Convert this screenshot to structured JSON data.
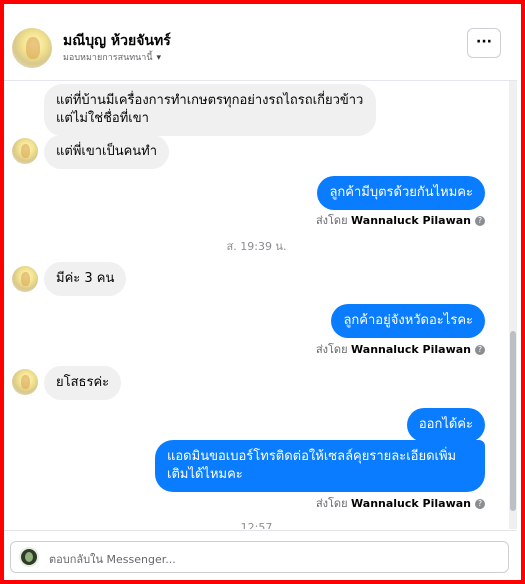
{
  "header": {
    "contact_name": "มณีบุญ ห้วยจันทร์",
    "assign_label": "มอบหมายการสนทนานี้",
    "caret_icon": "▾",
    "more_icon": "···"
  },
  "messages": {
    "m1": "แต่ที่บ้านมีเครื่องการทำเกษตรทุกอย่างรถไถรถเกี่ยวข้าวแต่ไม่ใช่ชื่อที่เขา",
    "m2": "แต่พี่เขาเป็นคนทำ",
    "m3": "ลูกค้ามีบุตรด้วยกันไหมคะ",
    "m3_sent_prefix": "ส่งโดย",
    "m3_sent_name": "Wannaluck Pilawan",
    "time1": "ส. 19:39 น.",
    "m4": "มีค่ะ 3 คน",
    "m5": "ลูกค้าอยู่จังหวัดอะไรคะ",
    "m5_sent_prefix": "ส่งโดย",
    "m5_sent_name": "Wannaluck Pilawan",
    "m6": "ยโสธรค่ะ",
    "m7": "ออกได้ค่ะ",
    "m8": "แอดมินขอเบอร์โทรติดต่อให้เซลล์คุยรายละเอียดเพิ่มเติมได้ไหมคะ",
    "m8_sent_prefix": "ส่งโดย",
    "m8_sent_name": "Wannaluck Pilawan",
    "time2": "12:57"
  },
  "composer": {
    "placeholder": "ตอบกลับใน Messenger..."
  },
  "colors": {
    "outgoing_bubble": "#0a7cff",
    "incoming_bubble": "#f0f0f0",
    "frame_border": "#ff0000"
  },
  "icons": {
    "info": "?"
  }
}
